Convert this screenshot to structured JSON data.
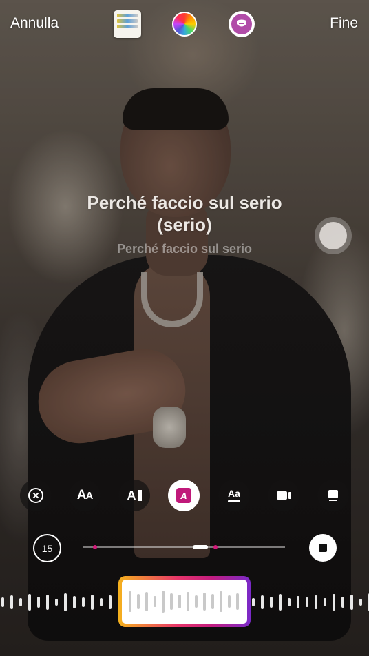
{
  "header": {
    "cancel_label": "Annulla",
    "done_label": "Fine"
  },
  "lyrics": {
    "current": "Perché faccio sul serio (serio)",
    "next": "Perché faccio sul serio"
  },
  "toolbar": {
    "tools": [
      "close",
      "text-style-small-caps",
      "text-style-block",
      "text-style-highlight",
      "text-style-underline",
      "camera-style",
      "card-style"
    ],
    "selected": "text-style-highlight",
    "accent_color": "#c0197a"
  },
  "timeline": {
    "duration_label": "15"
  },
  "colors": {
    "gradient_start": "#f5b21d",
    "gradient_mid": "#e8356a",
    "gradient_end": "#7a2ac9",
    "marker": "#d11a7a"
  }
}
